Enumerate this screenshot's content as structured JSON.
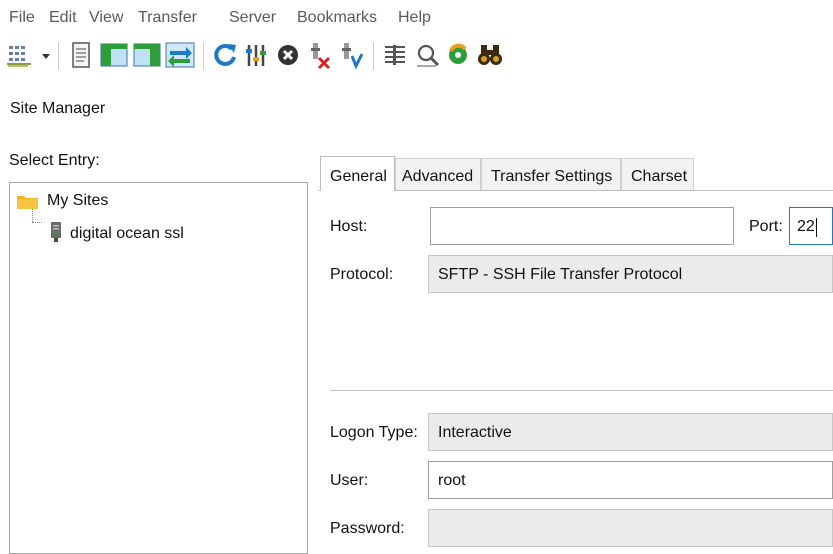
{
  "menubar": {
    "items": [
      "File",
      "Edit",
      "View",
      "Transfer",
      "Server",
      "Bookmarks",
      "Help"
    ]
  },
  "toolbar": {
    "buttons": [
      "site-manager-icon",
      "dropdown-arrow-icon",
      "message-log-icon",
      "local-tree-icon",
      "remote-tree-icon",
      "transfer-queue-icon",
      "refresh-icon",
      "filter-icon",
      "cancel-icon",
      "disconnect-icon",
      "reconnect-icon",
      "directory-compare-icon",
      "search-files-icon",
      "sync-browsing-icon",
      "find-binoculars-icon"
    ]
  },
  "site_manager": {
    "title": "Site Manager",
    "select_entry_label": "Select Entry:",
    "tree": {
      "root_label": "My Sites",
      "site_label": "digital ocean ssl"
    },
    "tabs": [
      "General",
      "Advanced",
      "Transfer Settings",
      "Charset"
    ],
    "general": {
      "host_label": "Host:",
      "host_value": "",
      "port_label": "Port:",
      "port_value": "22",
      "protocol_label": "Protocol:",
      "protocol_value": "SFTP - SSH File Transfer Protocol",
      "logon_type_label": "Logon Type:",
      "logon_type_value": "Interactive",
      "user_label": "User:",
      "user_value": "root",
      "password_label": "Password:",
      "password_value": ""
    }
  },
  "colors": {
    "folder": "#f5b220",
    "accent_blue": "#1f78c8",
    "accent_green": "#2e9e3a",
    "cancel_dark": "#333333",
    "red_x": "#d92121",
    "panel_gray": "#ebebeb"
  }
}
